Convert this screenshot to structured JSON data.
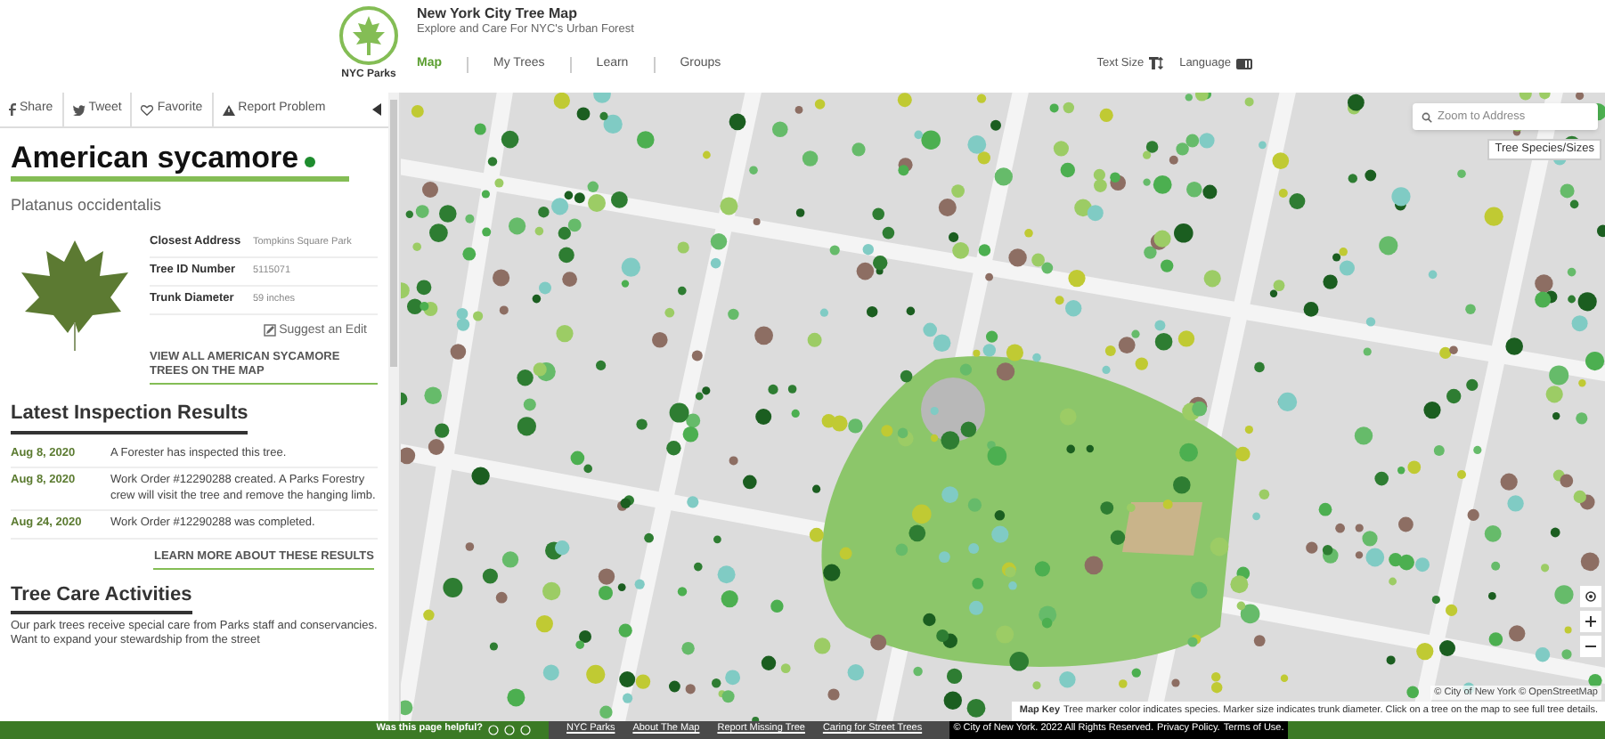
{
  "header": {
    "logo_text": "NYC Parks",
    "title": "New York City Tree Map",
    "subtitle": "Explore and Care For NYC's Urban Forest",
    "nav": [
      {
        "label": "Map",
        "selected": true
      },
      {
        "label": "My Trees",
        "selected": false
      },
      {
        "label": "Learn",
        "selected": false
      },
      {
        "label": "Groups",
        "selected": false
      }
    ],
    "text_size": "Text Size",
    "language": "Language"
  },
  "sidebar": {
    "share_bar": [
      {
        "kind": "facebook",
        "label": "Share"
      },
      {
        "kind": "twitter",
        "label": "Tweet"
      },
      {
        "kind": "heart",
        "label": "Favorite"
      },
      {
        "kind": "warning",
        "label": "Report Problem"
      }
    ],
    "common_name": "American sycamore",
    "scientific_name": "Platanus occidentalis",
    "details": [
      {
        "label": "Closest Address",
        "value": "Tompkins Square Park"
      },
      {
        "label": "Tree ID Number",
        "value": "5115071"
      },
      {
        "label": "Trunk Diameter",
        "value": "59 inches"
      }
    ],
    "suggest_edit": "Suggest an Edit",
    "view_all": "VIEW ALL AMERICAN SYCAMORE TREES ON THE MAP",
    "inspection_heading": "Latest Inspection Results",
    "inspections": [
      {
        "date": "Aug 8, 2020",
        "text": "A Forester has inspected this tree."
      },
      {
        "date": "Aug 8, 2020",
        "text": "Work Order #12290288 created. A Parks Forestry crew will visit the tree and remove the hanging limb."
      },
      {
        "date": "Aug 24, 2020",
        "text": "Work Order #12290288 was completed."
      }
    ],
    "learn_more": "LEARN MORE ABOUT THESE RESULTS",
    "care_heading": "Tree Care Activities",
    "care_text": "Our park trees receive special care from Parks staff and conservancies. Want to expand your stewardship from the street"
  },
  "map": {
    "search_placeholder": "Zoom to Address",
    "species_button": "Tree Species/Sizes",
    "attribution": "© City of New York © OpenStreetMap",
    "key_label": "Map Key",
    "key_text": "Tree marker color indicates species. Marker size indicates trunk diameter. Click on a tree on the map to see full tree details."
  },
  "footer": {
    "feedback": "Was this page helpful?",
    "links": [
      "NYC Parks",
      "About The Map",
      "Report Missing Tree",
      "Caring for Street Trees"
    ],
    "copyright": "© City of New York. 2022 All Rights Reserved.",
    "privacy": "Privacy Policy.",
    "terms": "Terms of Use."
  }
}
